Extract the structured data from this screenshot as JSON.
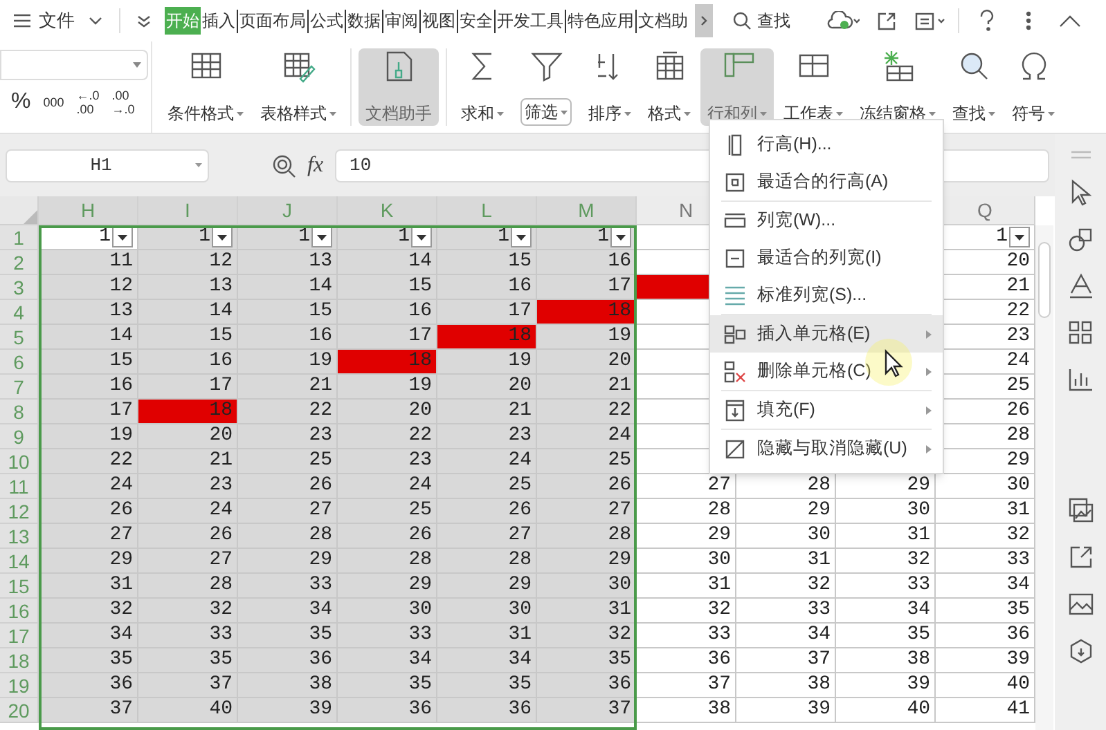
{
  "top_bar": {
    "file_menu": "文件",
    "tabs": [
      {
        "label": "开始",
        "selected": true
      },
      {
        "label": "插入",
        "selected": false
      },
      {
        "label": "页面布局",
        "selected": false
      },
      {
        "label": "公式",
        "selected": false
      },
      {
        "label": "数据",
        "selected": false
      },
      {
        "label": "审阅",
        "selected": false
      },
      {
        "label": "视图",
        "selected": false
      },
      {
        "label": "安全",
        "selected": false
      },
      {
        "label": "开发工具",
        "selected": false
      },
      {
        "label": "特色应用",
        "selected": false
      },
      {
        "label": "文档助",
        "selected": false
      }
    ],
    "search": "查找"
  },
  "ribbon": {
    "number_format": [
      "%",
      "000"
    ],
    "decimal_buttons": [
      [
        "←.0",
        ".00"
      ],
      [
        ".00",
        "→.0"
      ]
    ],
    "buttons": [
      {
        "label": "条件格式",
        "dropdown": true,
        "pressed": false,
        "hovered": false
      },
      {
        "label": "表格样式",
        "dropdown": true,
        "pressed": false,
        "hovered": false
      },
      {
        "label": "文档助手",
        "dropdown": false,
        "pressed": true,
        "hovered": false
      },
      {
        "label": "求和",
        "dropdown": true,
        "pressed": false,
        "hovered": false
      },
      {
        "label": "筛选",
        "dropdown": true,
        "pressed": false,
        "hovered": true
      },
      {
        "label": "排序",
        "dropdown": true,
        "pressed": false,
        "hovered": false
      },
      {
        "label": "格式",
        "dropdown": true,
        "pressed": false,
        "hovered": false
      },
      {
        "label": "行和列",
        "dropdown": true,
        "pressed": true,
        "hovered": false
      },
      {
        "label": "工作表",
        "dropdown": true,
        "pressed": false,
        "hovered": false
      },
      {
        "label": "冻结窗格",
        "dropdown": true,
        "pressed": false,
        "hovered": false
      },
      {
        "label": "查找",
        "dropdown": true,
        "pressed": false,
        "hovered": false
      },
      {
        "label": "符号",
        "dropdown": true,
        "pressed": false,
        "hovered": false
      }
    ]
  },
  "formula_bar": {
    "name_box": "H1",
    "function_label": "fx",
    "formula": "10"
  },
  "sheet": {
    "columns": [
      {
        "label": "H",
        "selected": true
      },
      {
        "label": "I",
        "selected": true
      },
      {
        "label": "J",
        "selected": true
      },
      {
        "label": "K",
        "selected": true
      },
      {
        "label": "L",
        "selected": true
      },
      {
        "label": "M",
        "selected": true
      },
      {
        "label": "N",
        "selected": false
      },
      {},
      {},
      {
        "label": "Q",
        "selected": false
      }
    ],
    "rows": [
      {
        "number": "1",
        "selected": true,
        "cells": [
          {
            "value": "1",
            "filter": true,
            "active": true
          },
          {
            "value": "1",
            "filter": true
          },
          {
            "value": "1",
            "filter": true
          },
          {
            "value": "1",
            "filter": true
          },
          {
            "value": "1",
            "filter": true
          },
          {
            "value": "1",
            "filter": true
          },
          {},
          {},
          {},
          {
            "value": "1",
            "filter": true
          }
        ]
      },
      {
        "number": "2",
        "selected": true,
        "cells": [
          {
            "value": "11"
          },
          {
            "value": "12"
          },
          {
            "value": "13"
          },
          {
            "value": "14"
          },
          {
            "value": "15"
          },
          {
            "value": "16"
          },
          {},
          {},
          {},
          {
            "value": "20"
          }
        ]
      },
      {
        "number": "3",
        "selected": true,
        "cells": [
          {
            "value": "12"
          },
          {
            "value": "13"
          },
          {
            "value": "14"
          },
          {
            "value": "15"
          },
          {
            "value": "16"
          },
          {
            "value": "17"
          },
          {
            "highlighted": true
          },
          {},
          {},
          {
            "value": "21"
          }
        ]
      },
      {
        "number": "4",
        "selected": true,
        "cells": [
          {
            "value": "13"
          },
          {
            "value": "14"
          },
          {
            "value": "15"
          },
          {
            "value": "16"
          },
          {
            "value": "17"
          },
          {
            "value": "18",
            "highlighted": true
          },
          {},
          {},
          {},
          {
            "value": "22"
          }
        ]
      },
      {
        "number": "5",
        "selected": true,
        "cells": [
          {
            "value": "14"
          },
          {
            "value": "15"
          },
          {
            "value": "16"
          },
          {
            "value": "17"
          },
          {
            "value": "18",
            "highlighted": true
          },
          {
            "value": "19"
          },
          {},
          {},
          {},
          {
            "value": "23"
          }
        ]
      },
      {
        "number": "6",
        "selected": true,
        "cells": [
          {
            "value": "15"
          },
          {
            "value": "16"
          },
          {
            "value": "19"
          },
          {
            "value": "18",
            "highlighted": true
          },
          {
            "value": "19"
          },
          {
            "value": "20"
          },
          {},
          {},
          {},
          {
            "value": "24"
          }
        ]
      },
      {
        "number": "7",
        "selected": true,
        "cells": [
          {
            "value": "16"
          },
          {
            "value": "17"
          },
          {
            "value": "21"
          },
          {
            "value": "19"
          },
          {
            "value": "20"
          },
          {
            "value": "21"
          },
          {},
          {},
          {},
          {
            "value": "25"
          }
        ]
      },
      {
        "number": "8",
        "selected": true,
        "cells": [
          {
            "value": "17"
          },
          {
            "value": "18",
            "highlighted": true
          },
          {
            "value": "22"
          },
          {
            "value": "20"
          },
          {
            "value": "21"
          },
          {
            "value": "22"
          },
          {},
          {},
          {},
          {
            "value": "26"
          }
        ]
      },
      {
        "number": "9",
        "selected": true,
        "cells": [
          {
            "value": "19"
          },
          {
            "value": "20"
          },
          {
            "value": "23"
          },
          {
            "value": "22"
          },
          {
            "value": "23"
          },
          {
            "value": "24"
          },
          {},
          {},
          {},
          {
            "value": "28"
          }
        ]
      },
      {
        "number": "10",
        "selected": true,
        "cells": [
          {
            "value": "22"
          },
          {
            "value": "21"
          },
          {
            "value": "25"
          },
          {
            "value": "23"
          },
          {
            "value": "24"
          },
          {
            "value": "25"
          },
          {},
          {},
          {},
          {
            "value": "29"
          }
        ]
      },
      {
        "number": "11",
        "selected": true,
        "cells": [
          {
            "value": "24"
          },
          {
            "value": "23"
          },
          {
            "value": "26"
          },
          {
            "value": "24"
          },
          {
            "value": "25"
          },
          {
            "value": "26"
          },
          {
            "value": "27"
          },
          {
            "value": "28"
          },
          {
            "value": "29"
          },
          {
            "value": "30"
          }
        ]
      },
      {
        "number": "12",
        "selected": true,
        "cells": [
          {
            "value": "26"
          },
          {
            "value": "24"
          },
          {
            "value": "27"
          },
          {
            "value": "25"
          },
          {
            "value": "26"
          },
          {
            "value": "27"
          },
          {
            "value": "28"
          },
          {
            "value": "29"
          },
          {
            "value": "30"
          },
          {
            "value": "31"
          }
        ]
      },
      {
        "number": "13",
        "selected": true,
        "cells": [
          {
            "value": "27"
          },
          {
            "value": "26"
          },
          {
            "value": "28"
          },
          {
            "value": "26"
          },
          {
            "value": "27"
          },
          {
            "value": "28"
          },
          {
            "value": "29"
          },
          {
            "value": "30"
          },
          {
            "value": "31"
          },
          {
            "value": "32"
          }
        ]
      },
      {
        "number": "14",
        "selected": true,
        "cells": [
          {
            "value": "29"
          },
          {
            "value": "27"
          },
          {
            "value": "29"
          },
          {
            "value": "28"
          },
          {
            "value": "28"
          },
          {
            "value": "29"
          },
          {
            "value": "30"
          },
          {
            "value": "31"
          },
          {
            "value": "32"
          },
          {
            "value": "33"
          }
        ]
      },
      {
        "number": "15",
        "selected": true,
        "cells": [
          {
            "value": "31"
          },
          {
            "value": "28"
          },
          {
            "value": "33"
          },
          {
            "value": "29"
          },
          {
            "value": "29"
          },
          {
            "value": "30"
          },
          {
            "value": "31"
          },
          {
            "value": "32"
          },
          {
            "value": "33"
          },
          {
            "value": "34"
          }
        ]
      },
      {
        "number": "16",
        "selected": true,
        "cells": [
          {
            "value": "32"
          },
          {
            "value": "32"
          },
          {
            "value": "34"
          },
          {
            "value": "30"
          },
          {
            "value": "30"
          },
          {
            "value": "31"
          },
          {
            "value": "32"
          },
          {
            "value": "33"
          },
          {
            "value": "34"
          },
          {
            "value": "35"
          }
        ]
      },
      {
        "number": "17",
        "selected": true,
        "cells": [
          {
            "value": "34"
          },
          {
            "value": "33"
          },
          {
            "value": "35"
          },
          {
            "value": "33"
          },
          {
            "value": "31"
          },
          {
            "value": "32"
          },
          {
            "value": "33"
          },
          {
            "value": "34"
          },
          {
            "value": "35"
          },
          {
            "value": "36"
          }
        ]
      },
      {
        "number": "18",
        "selected": true,
        "cells": [
          {
            "value": "35"
          },
          {
            "value": "35"
          },
          {
            "value": "36"
          },
          {
            "value": "34"
          },
          {
            "value": "34"
          },
          {
            "value": "35"
          },
          {
            "value": "36"
          },
          {
            "value": "37"
          },
          {
            "value": "38"
          },
          {
            "value": "39"
          }
        ]
      },
      {
        "number": "19",
        "selected": true,
        "cells": [
          {
            "value": "36"
          },
          {
            "value": "37"
          },
          {
            "value": "38"
          },
          {
            "value": "35"
          },
          {
            "value": "35"
          },
          {
            "value": "36"
          },
          {
            "value": "37"
          },
          {
            "value": "38"
          },
          {
            "value": "39"
          },
          {
            "value": "40"
          }
        ]
      },
      {
        "number": "20",
        "selected": true,
        "cells": [
          {
            "value": "37"
          },
          {
            "value": "40"
          },
          {
            "value": "39"
          },
          {
            "value": "36"
          },
          {
            "value": "36"
          },
          {
            "value": "37"
          },
          {
            "value": "38"
          },
          {
            "value": "39"
          },
          {
            "value": "40"
          },
          {
            "value": "41"
          }
        ]
      }
    ]
  },
  "context_menu": {
    "items": [
      {
        "kind": "item",
        "label": "行高(H)...",
        "submenu": false,
        "selected": false
      },
      {
        "kind": "item",
        "label": "最适合的行高(A)",
        "submenu": false,
        "selected": false
      },
      {
        "kind": "separator"
      },
      {
        "kind": "item",
        "label": "列宽(W)...",
        "submenu": false,
        "selected": false
      },
      {
        "kind": "item",
        "label": "最适合的列宽(I)",
        "submenu": false,
        "selected": false
      },
      {
        "kind": "item",
        "label": "标准列宽(S)...",
        "submenu": false,
        "selected": false
      },
      {
        "kind": "separator"
      },
      {
        "kind": "item",
        "label": "插入单元格(E)",
        "submenu": true,
        "selected": true
      },
      {
        "kind": "item",
        "label": "删除单元格(C)",
        "submenu": true,
        "selected": false
      },
      {
        "kind": "separator"
      },
      {
        "kind": "item",
        "label": "填充(F)",
        "submenu": true,
        "selected": false
      },
      {
        "kind": "separator"
      },
      {
        "kind": "item",
        "label": "隐藏与取消隐藏(U)",
        "submenu": true,
        "selected": false
      }
    ]
  }
}
